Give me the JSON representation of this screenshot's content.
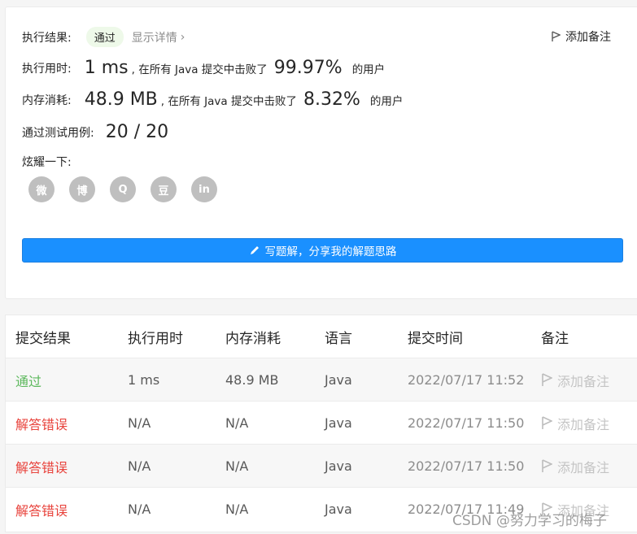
{
  "summary": {
    "result_label": "执行结果:",
    "result_badge": "通过",
    "details_link": "显示详情",
    "add_note": "添加备注",
    "runtime_label": "执行用时:",
    "runtime_value": "1 ms",
    "runtime_text": ", 在所有 Java 提交中击败了",
    "runtime_percent": "99.97%",
    "runtime_suffix": "的用户",
    "memory_label": "内存消耗:",
    "memory_value": "48.9 MB",
    "memory_text": ", 在所有 Java 提交中击败了",
    "memory_percent": "8.32%",
    "memory_suffix": "的用户",
    "tests_label": "通过测试用例:",
    "tests_value": "20 / 20",
    "share_label": "炫耀一下:",
    "share_icons": [
      "wechat-icon",
      "weibo-icon",
      "qq-icon",
      "douban-icon",
      "linkedin-icon"
    ],
    "share_glyphs": [
      "微",
      "博",
      "Q",
      "豆",
      "in"
    ],
    "write_button": "写题解，分享我的解题思路"
  },
  "table": {
    "headers": [
      "提交结果",
      "执行用时",
      "内存消耗",
      "语言",
      "提交时间",
      "备注"
    ],
    "rows": [
      {
        "result": "通过",
        "status": "pass",
        "runtime": "1 ms",
        "memory": "48.9 MB",
        "language": "Java",
        "time": "2022/07/17 11:52",
        "note": "添加备注"
      },
      {
        "result": "解答错误",
        "status": "fail",
        "runtime": "N/A",
        "memory": "N/A",
        "language": "Java",
        "time": "2022/07/17 11:50",
        "note": "添加备注"
      },
      {
        "result": "解答错误",
        "status": "fail",
        "runtime": "N/A",
        "memory": "N/A",
        "language": "Java",
        "time": "2022/07/17 11:50",
        "note": "添加备注"
      },
      {
        "result": "解答错误",
        "status": "fail",
        "runtime": "N/A",
        "memory": "N/A",
        "language": "Java",
        "time": "2022/07/17 11:49",
        "note": "添加备注"
      }
    ]
  },
  "watermark": "CSDN @努力学习的梅子",
  "colors": {
    "pass": "#5cb85c",
    "fail": "#e8433c",
    "button": "#1a90ff"
  }
}
